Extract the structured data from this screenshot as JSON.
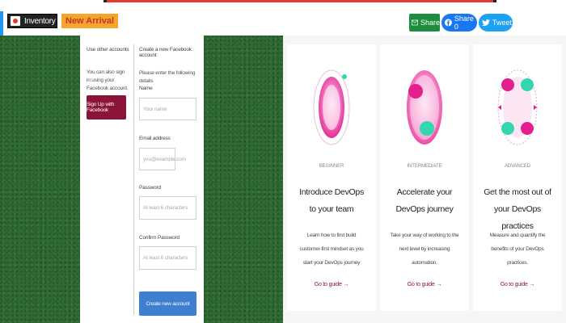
{
  "header": {
    "inventory_badge": "Inventory",
    "new_arrival_badge": "New Arrival",
    "share": {
      "share_label": "Share",
      "facebook_label": "Share 0",
      "tweet_label": "Tweet"
    }
  },
  "form": {
    "left_heading": "Use other accounts",
    "left_text": "You can also sign in using your Facebook account.",
    "facebook_button": "Sign Up with Facebook",
    "right_heading": "Create a new Facebook account",
    "right_subtext": "Please enter the following details",
    "name_label": "Name",
    "name_placeholder": "Your name",
    "email_label": "Email address",
    "email_placeholder": "you@example.com",
    "password_label": "Password",
    "password_placeholder": "At least 6 characters",
    "confirm_label": "Confirm Password",
    "confirm_placeholder": "At least 6 characters",
    "create_button": "Create new account"
  },
  "cards": [
    {
      "eyebrow": "BEGINNER",
      "title": "Introduce DevOps to your team",
      "description": "Learn how to first build customer-first mindset as you start your DevOps journey",
      "link": "Go to guide →"
    },
    {
      "eyebrow": "INTERMEDIATE",
      "title": "Accelerate your DevOps journey",
      "description": "Take your way of working to the next level by increasing automation.",
      "link": "Go to guide →"
    },
    {
      "eyebrow": "ADVANCED",
      "title": "Get the most out of your DevOps practices",
      "description": "Measure and quantify the benefits of your DevOps practices.",
      "link": "Go to guide →"
    }
  ],
  "colors": {
    "accent": "#8a1538",
    "primary_button": "#3f7fcf",
    "grass": "#2e6b32",
    "share_green": "#1e8e3e",
    "facebook_blue": "#1877f2",
    "twitter_blue": "#1da1f2"
  }
}
